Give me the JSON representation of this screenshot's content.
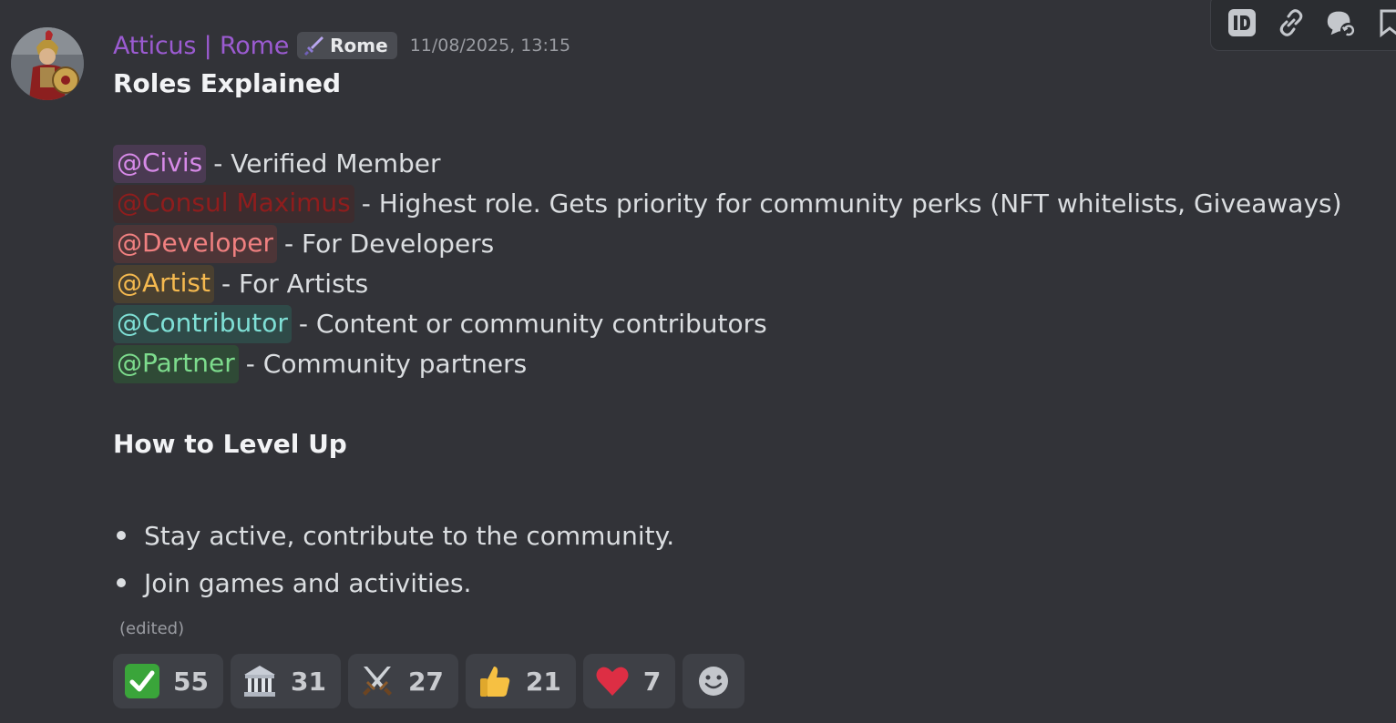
{
  "author": {
    "name": "Atticus | Rome",
    "tag": "Rome",
    "timestamp": "11/08/2025, 13:15"
  },
  "message": {
    "heading_roles": "Roles Explained",
    "roles": [
      {
        "mention": "@Civis",
        "desc": "- Verified Member",
        "color": "#d78ae8",
        "bg": "#4a3a52"
      },
      {
        "mention": "@Consul Maximus",
        "desc": "- Highest role. Gets priority for community perks (NFT whitelists, Giveaways)",
        "color": "#8f1d1d",
        "bg": "#3d2c2e"
      },
      {
        "mention": "@Developer",
        "desc": "- For Developers",
        "color": "#f08080",
        "bg": "#4d3537"
      },
      {
        "mention": "@Artist",
        "desc": "- For Artists",
        "color": "#f5b94f",
        "bg": "#4a4030"
      },
      {
        "mention": "@Contributor",
        "desc": "- Content or community contributors",
        "color": "#7fe0d6",
        "bg": "#2f4a48"
      },
      {
        "mention": "@Partner",
        "desc": "- Community partners",
        "color": "#7ddc8d",
        "bg": "#2f4a36"
      }
    ],
    "heading_level": "How to Level Up",
    "bullets": [
      "Stay active, contribute to the community.",
      "Join games and activities."
    ],
    "edited_label": "(edited)"
  },
  "reactions": [
    {
      "emoji": "check-mark-button",
      "count": "55"
    },
    {
      "emoji": "classical-building",
      "count": "31"
    },
    {
      "emoji": "crossed-swords",
      "count": "27"
    },
    {
      "emoji": "thumbs-up",
      "count": "21"
    },
    {
      "emoji": "red-heart",
      "count": "7"
    }
  ],
  "toolbar": [
    "copy-id-icon",
    "copy-link-icon",
    "reply-icon",
    "bookmark-icon"
  ],
  "colors": {
    "background": "#323338",
    "username": "#9b5bd1",
    "timestamp": "#9a9ca2",
    "reaction_bg": "#3e4046"
  }
}
